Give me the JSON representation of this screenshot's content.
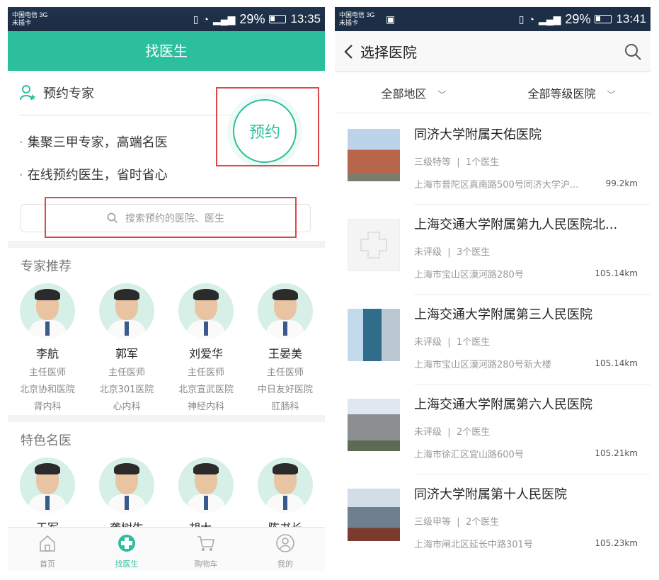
{
  "left": {
    "status": {
      "carrier": "中国电信 3G",
      "sim": "未插卡",
      "battery": "29%",
      "time": "13:35"
    },
    "header_title": "找医生",
    "booking": {
      "title": "预约专家",
      "features": [
        "集聚三甲专家，高端名医",
        "在线预约医生，省时省心"
      ],
      "button_label": "预约"
    },
    "search": {
      "placeholder": "搜索预约的医院、医生"
    },
    "experts": {
      "title": "专家推荐",
      "doctors": [
        {
          "name": "李航",
          "title": "主任医师",
          "hospital": "北京协和医院",
          "dept": "肾内科"
        },
        {
          "name": "郭军",
          "title": "主任医师",
          "hospital": "北京301医院",
          "dept": "心内科"
        },
        {
          "name": "刘爱华",
          "title": "主任医师",
          "hospital": "北京宣武医院",
          "dept": "神经内科"
        },
        {
          "name": "王晏美",
          "title": "主任医师",
          "hospital": "中日友好医院",
          "dept": "肛肠科"
        }
      ]
    },
    "famous": {
      "title": "特色名医",
      "doctors": [
        {
          "name": "王军"
        },
        {
          "name": "龚树生"
        },
        {
          "name": "胡大一"
        },
        {
          "name": "陈书长"
        }
      ]
    },
    "tabs": [
      {
        "label": "首页",
        "icon": "home-icon"
      },
      {
        "label": "找医生",
        "icon": "plus-circle-icon"
      },
      {
        "label": "购物车",
        "icon": "cart-icon"
      },
      {
        "label": "我的",
        "icon": "user-icon"
      }
    ],
    "accent": "#2cbf9d"
  },
  "right": {
    "status": {
      "carrier": "中国电信 3G",
      "sim": "未插卡",
      "battery": "29%",
      "time": "13:41"
    },
    "title": "选择医院",
    "filters": [
      "全部地区",
      "全部等级医院"
    ],
    "hospitals": [
      {
        "name": "同济大学附属天佑医院",
        "level": "三级特等",
        "doctors": "1个医生",
        "address": "上海市普陀区真南路500号同济大学沪...",
        "distance": "99.2km"
      },
      {
        "name": "上海交通大学附属第九人民医院北...",
        "level": "未评级",
        "doctors": "3个医生",
        "address": "上海市宝山区漠河路280号",
        "distance": "105.14km"
      },
      {
        "name": "上海交通大学附属第三人民医院",
        "level": "未评级",
        "doctors": "1个医生",
        "address": "上海市宝山区漠河路280号新大楼",
        "distance": "105.14km"
      },
      {
        "name": "上海交通大学附属第六人民医院",
        "level": "未评级",
        "doctors": "2个医生",
        "address": "上海市徐汇区宜山路600号",
        "distance": "105.21km"
      },
      {
        "name": "同济大学附属第十人民医院",
        "level": "三级甲等",
        "doctors": "2个医生",
        "address": "上海市闸北区延长中路301号",
        "distance": "105.23km"
      }
    ]
  }
}
